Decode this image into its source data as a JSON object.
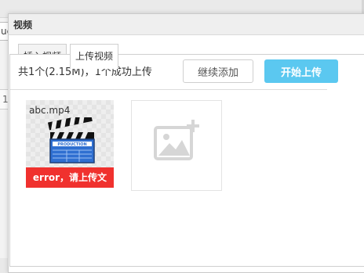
{
  "background": {
    "left_input_text": "ue",
    "left_box_text": "1"
  },
  "dialog": {
    "title": "视频",
    "tabs": [
      {
        "label": "插入视频",
        "active": false
      },
      {
        "label": "上传视频",
        "active": true
      }
    ]
  },
  "upload": {
    "status_text": "共1个(2.15M)，1个成功上传",
    "continue_label": "继续添加",
    "start_label": "开始上传",
    "files": [
      {
        "name": "abc.mp4",
        "icon": "clapperboard-icon",
        "icon_text": "PRODUCTION",
        "error_text": "error，请上传文"
      }
    ],
    "add_icon": "add-image-icon"
  },
  "colors": {
    "accent": "#5bc8f0",
    "error": "#f0312e"
  }
}
